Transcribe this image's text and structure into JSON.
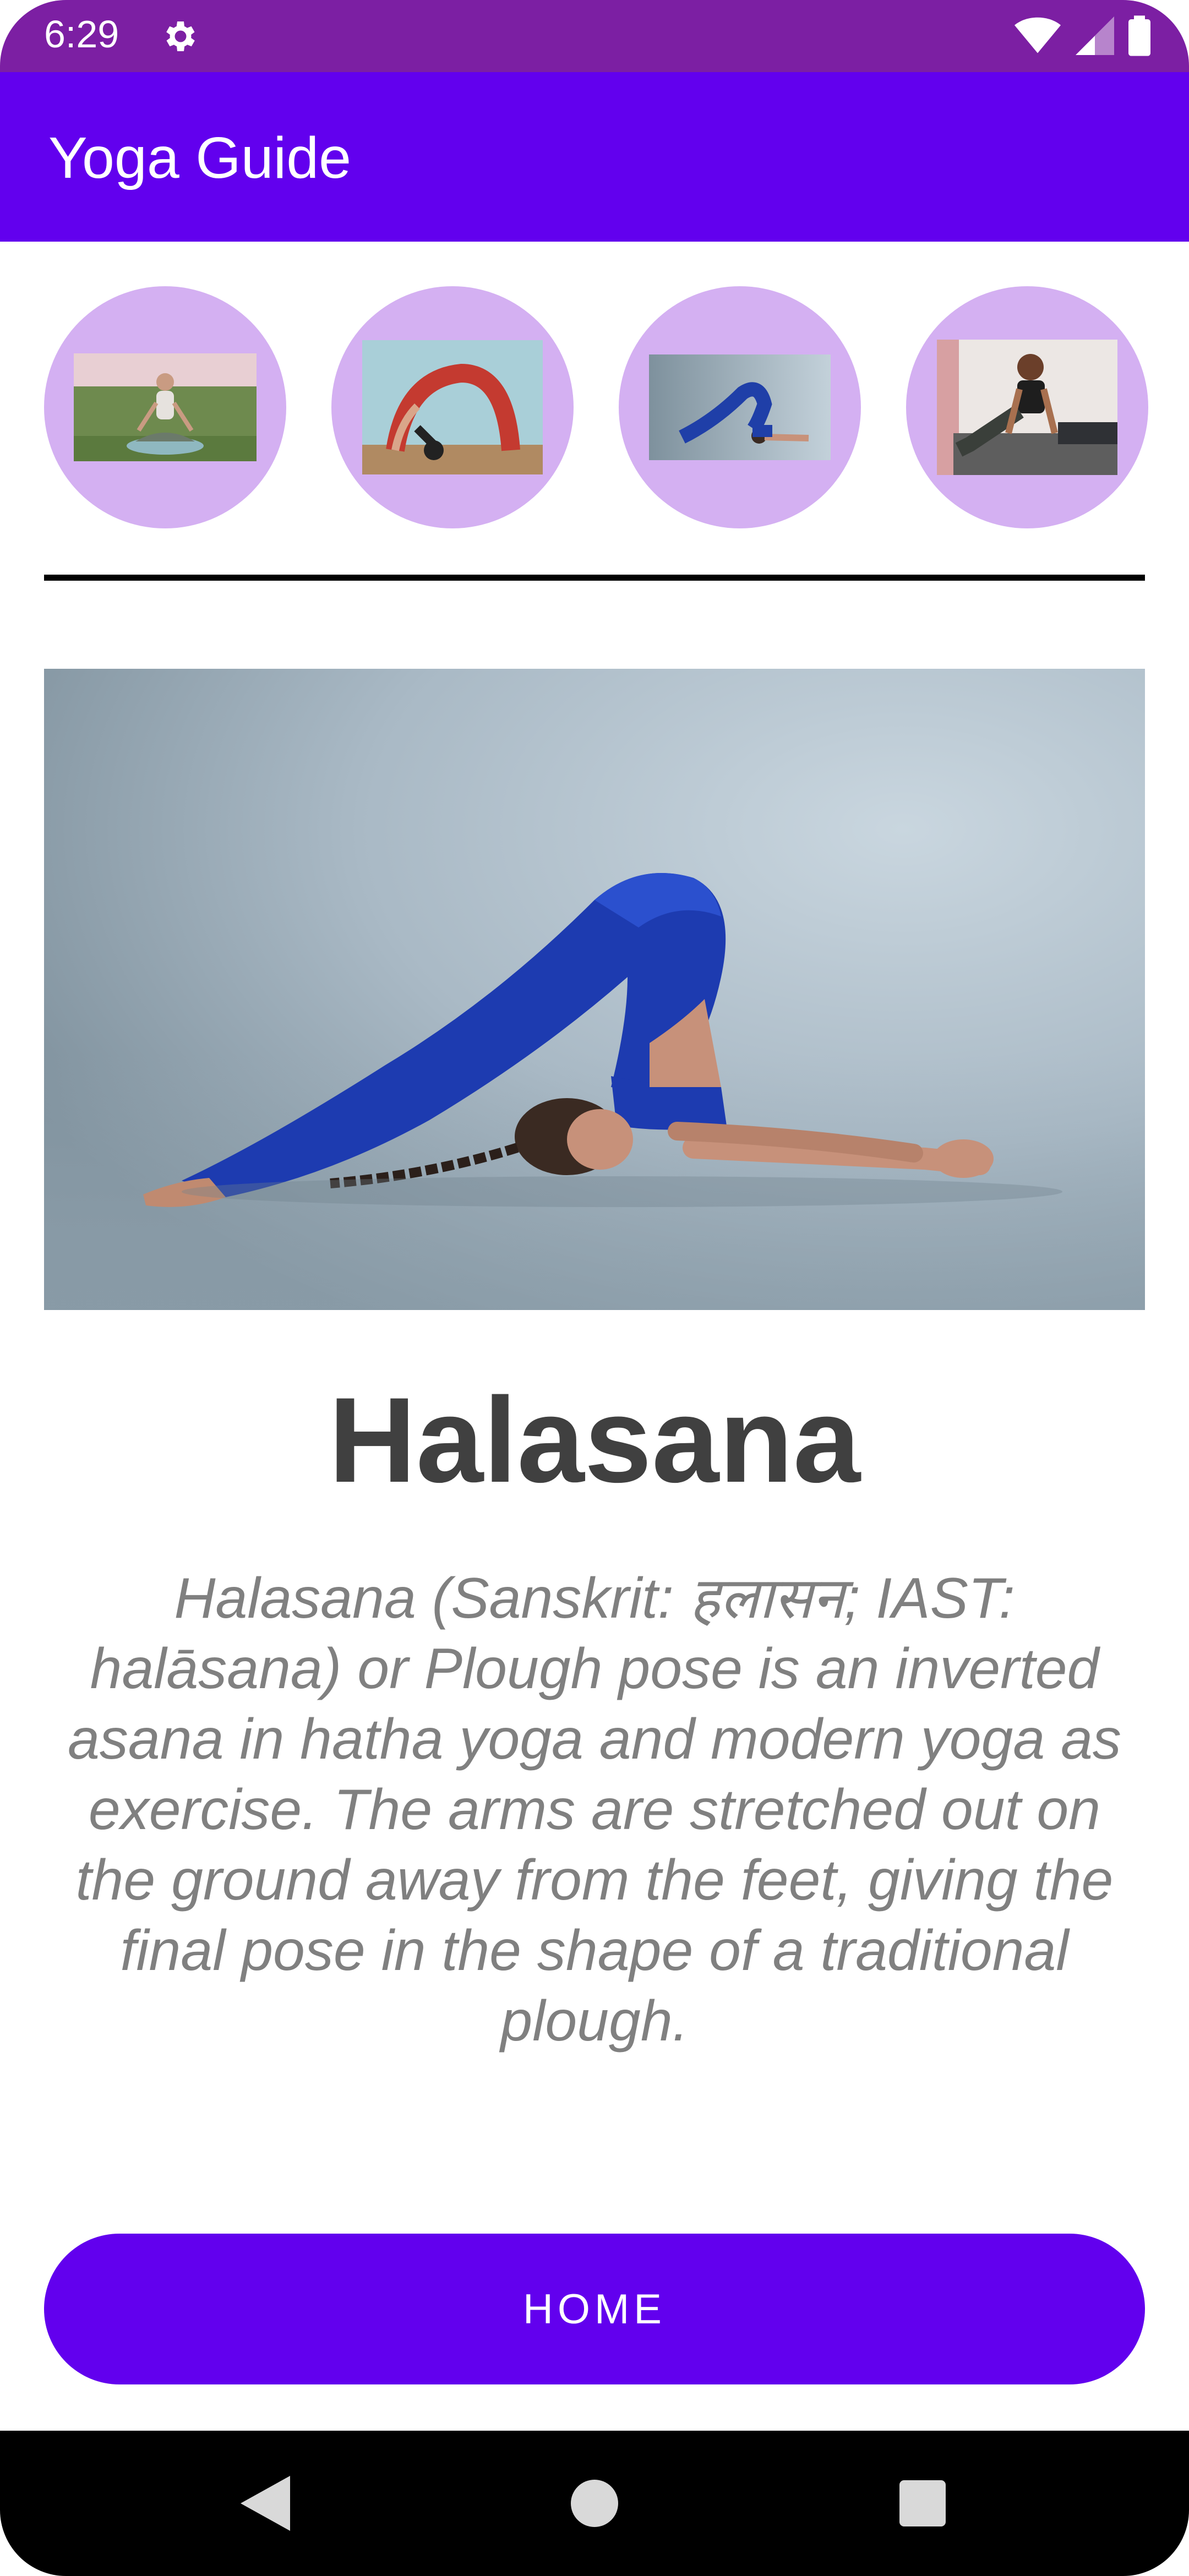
{
  "status_bar": {
    "time": "6:29",
    "icons": [
      "settings-icon",
      "wifi-icon",
      "cellular-signal-icon",
      "battery-icon"
    ]
  },
  "app_bar": {
    "title": "Yoga Guide",
    "color": "#6200ee"
  },
  "pose_thumbnails": [
    {
      "name": "pose-thumbnail-1",
      "image": "seated-meditation-photo"
    },
    {
      "name": "pose-thumbnail-2",
      "image": "wheel-pose-photo"
    },
    {
      "name": "pose-thumbnail-3",
      "image": "plough-pose-photo"
    },
    {
      "name": "pose-thumbnail-4",
      "image": "cobra-pose-photo"
    }
  ],
  "selected_pose": {
    "image": "plough-pose-hero-photo",
    "title": "Halasana",
    "description": "Halasana (Sanskrit: हलासन; IAST: halāsana) or Plough pose is an inverted asana in hatha yoga and modern yoga as exercise. The arms are stretched out on the ground away from the feet, giving the final pose in the shape of a traditional plough."
  },
  "home_button": {
    "label": "HOME"
  },
  "navigation_bar": {
    "buttons": [
      "back-icon",
      "home-circle-icon",
      "recents-square-icon"
    ]
  },
  "colors": {
    "status_bar": "#7c1fa3",
    "accent": "#6200ee",
    "thumbnail_circle": "#d4b0f2",
    "title_text": "#404040",
    "description_text": "#808080"
  }
}
